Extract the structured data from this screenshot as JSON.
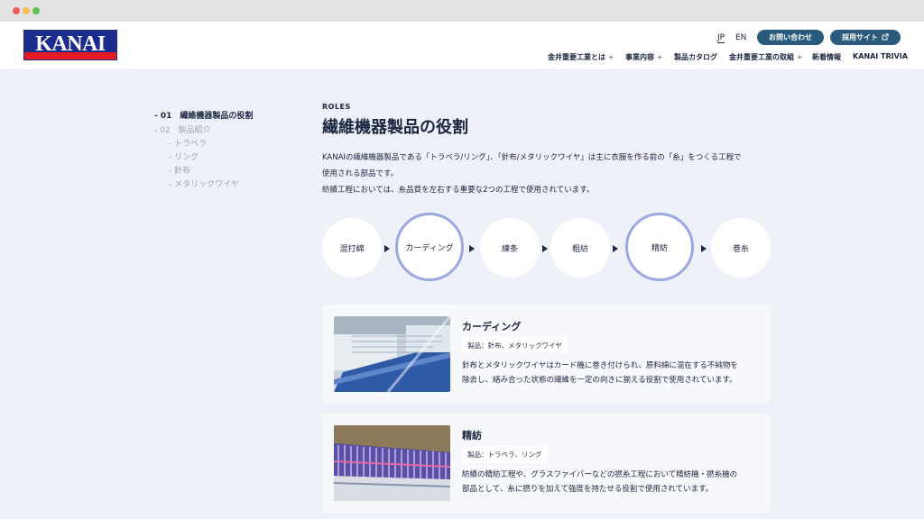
{
  "header": {
    "logo_text": "KANAI",
    "lang_jp": "JP",
    "lang_en": "EN",
    "contact_label": "お問い合わせ",
    "recruit_label": "採用サイト",
    "nav": [
      {
        "label": "金井重要工業とは",
        "has_plus": true
      },
      {
        "label": "事業内容",
        "has_plus": true
      },
      {
        "label": "製品カタログ",
        "has_plus": false
      },
      {
        "label": "金井重要工業の取組",
        "has_plus": true
      },
      {
        "label": "新着情報",
        "has_plus": false
      },
      {
        "label": "KANAI TRIVIA",
        "has_plus": false
      }
    ],
    "plus_symbol": "+"
  },
  "toc": {
    "item1": "- 01　繊維機器製品の役割",
    "item2": "- 02　製品紹介",
    "subs": [
      "- トラベラ",
      "- リング",
      "- 針布",
      "- メタリックワイヤ"
    ]
  },
  "main": {
    "eyebrow": "ROLES",
    "title": "繊維機器製品の役割",
    "intro_line1": "KANAIの繊維機器製品である「トラベラ/リング」、「針布/メタリックワイヤ」は主に衣服を作る前の「糸」をつくる工程で",
    "intro_line2": "使用される部品です。",
    "intro_line3": "紡績工程においては、糸品質を左右する重要な2つの工程で使用されています。"
  },
  "flow": [
    {
      "label": "混打綿",
      "active": false
    },
    {
      "label": "カーディング",
      "active": true
    },
    {
      "label": "練条",
      "active": false
    },
    {
      "label": "粗紡",
      "active": false
    },
    {
      "label": "精紡",
      "active": true
    },
    {
      "label": "巻糸",
      "active": false
    }
  ],
  "cards": [
    {
      "title": "カーディング",
      "tag": "製品：針布、メタリックワイヤ",
      "desc_line1": "針布とメタリックワイヤはカード機に巻き付けられ、原料綿に混在する不純物を",
      "desc_line2": "除去し、絡み合った状態の繊維を一定の向きに揃える役割で使用されています。"
    },
    {
      "title": "精紡",
      "tag": "製品：トラベラ、リング",
      "desc_line1": "紡績の精紡工程や、グラスファイバーなどの撚糸工程において精紡機・撚糸機の",
      "desc_line2": "部品として、糸に撚りを加えて強度を持たせる役割で使用されています。"
    }
  ],
  "icons": {
    "external_link": "external-link-icon",
    "arrow": "triangle-right-icon"
  },
  "colors": {
    "brand_blue": "#1c2c8c",
    "brand_red": "#e31b23",
    "pill_bg": "#2a5a7c",
    "active_ring": "#9aa7e0"
  }
}
